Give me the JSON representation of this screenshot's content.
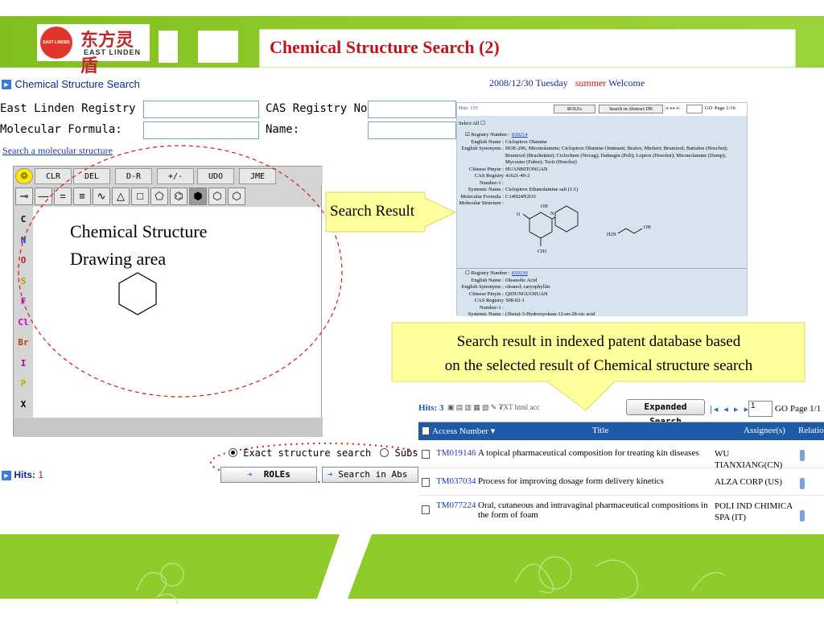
{
  "header": {
    "logo_cn": "东方灵盾",
    "logo_en": "EAST LINDEN",
    "logo_mark": "EAST LINDEN",
    "title": "Chemical Structure Search (2)"
  },
  "search_panel": {
    "heading": "Chemical Structure Search",
    "date_line": "2008/12/30 Tuesday",
    "season": "summer",
    "welcome": "Welcome",
    "fields": {
      "registry_label": "East Linden Registry No.:",
      "registry_value": "",
      "cas_label": "CAS Registry No.:",
      "cas_value": "",
      "formula_label": "Molecular Formula:",
      "formula_value": "",
      "name_label": "Name:",
      "name_value": ""
    },
    "draw_link": "Search a molecular structure",
    "toolbar": [
      "CLR",
      "DEL",
      "D-R",
      "+/-",
      "UDO",
      "JME"
    ],
    "elements": [
      "C",
      "N",
      "O",
      "S",
      "F",
      "Cl",
      "Br",
      "I",
      "P",
      "X"
    ],
    "element_colors": [
      "#000000",
      "#1e3cc8",
      "#c81e1e",
      "#b0a000",
      "#c800c8",
      "#c800c8",
      "#b04000",
      "#b000b0",
      "#c8a000",
      "#000000"
    ],
    "canvas_caption_1": "Chemical Structure",
    "canvas_caption_2": "Drawing area",
    "search_mode_exact": "Exact structure search",
    "search_mode_sub": "Substructure sea",
    "hits_label": "Hits:",
    "hits_value": "1",
    "roles_button": "ROLEs",
    "abstract_button": "Search in Abs"
  },
  "callouts": {
    "search_result": "Search Result",
    "patent_line1": "Search result in indexed patent database based",
    "patent_line2": "on the selected result of   Chemical structure search"
  },
  "result_panel": {
    "hits": "Hits: 155",
    "roles": "ROLEs",
    "abstract": "Search in Abstract DB",
    "go": "GO",
    "page": "Page 1/16",
    "select_all": "Select All",
    "record1": {
      "registry_label": "Registry Number :",
      "registry": "KI0214",
      "english_name_label": "English Name :",
      "english_name": "Ciclopirox Olamine",
      "synonyms_label": "English Synonyms :",
      "synonyms": "HOE-296; Miconolamine; Ciclopirox Olamine Ointment; Brafex; Michert; Brumixol; Batrafen (Hoechst); Brumixol (Bruchettini); Ciclochem (Novag); Dafnegin (Poli); Loprox (Hoechst); Miconolamine (Domp); Mycoster (Fabre); Tecit (Hoechst)",
      "pinyin_label": "Chinese Pinyin :",
      "pinyin": "HUANBITONGAN",
      "cas_label": "CAS Registry Number-1 :",
      "cas": "41621-49-2",
      "systemic_label": "Systemic Name :",
      "systemic": "Ciclopirox Ethanolamine salt (1:1)",
      "formula_label": "Molecular Formula :",
      "formula": "C14H24N2O3",
      "structure_label": "Molecular Structure :",
      "atoms": [
        "OH",
        "O",
        "N",
        "CH3",
        "H2N",
        "OH"
      ]
    },
    "record2": {
      "registry_label": "Registry Number :",
      "registry": "KI0230",
      "english_name_label": "English Name :",
      "english_name": "Oleanolic Acid",
      "synonyms_label": "English Synonyms :",
      "synonyms": "oleanol; caryophyllin",
      "pinyin_label": "Chinese Pinyin :",
      "pinyin": "QIDUNGUOSUAN",
      "cas_label": "CAS Registry Number-1 :",
      "cas": "508-02-1",
      "systemic_label": "Systemic Name :",
      "systemic": "(3beta)-3-Hydroxyolean-12-en-28-oic acid"
    }
  },
  "patent_results": {
    "hits": "Hits: 3",
    "tools": "TXT  html  acc",
    "expanded_button": "Expanded Search",
    "go": "GO",
    "page": "Page 1/1",
    "page_input": "1",
    "columns": [
      "Access Number",
      "Title",
      "Assignee(s)",
      "Relation"
    ],
    "rows": [
      {
        "id": "TM019146",
        "title": "A topical pharmaceutical composition for treating kin diseases",
        "assignee": "WU TIANXIANG(CN)"
      },
      {
        "id": "TM037034",
        "title": "Process for improving dosage form delivery kinetics",
        "assignee": "ALZA CORP (US)"
      },
      {
        "id": "TM077224",
        "title": "Oral, cutaneous and intravaginal pharmaceutical compositions in the form of foam",
        "assignee": "POLI IND CHIMICA SPA (IT)"
      }
    ]
  },
  "colors": {
    "header_green": "#8fcb2a",
    "title_red": "#c0141c",
    "callout_yellow": "#ffff9c",
    "table_header_blue": "#1e5aa8",
    "link_blue": "#1a3ab0"
  }
}
